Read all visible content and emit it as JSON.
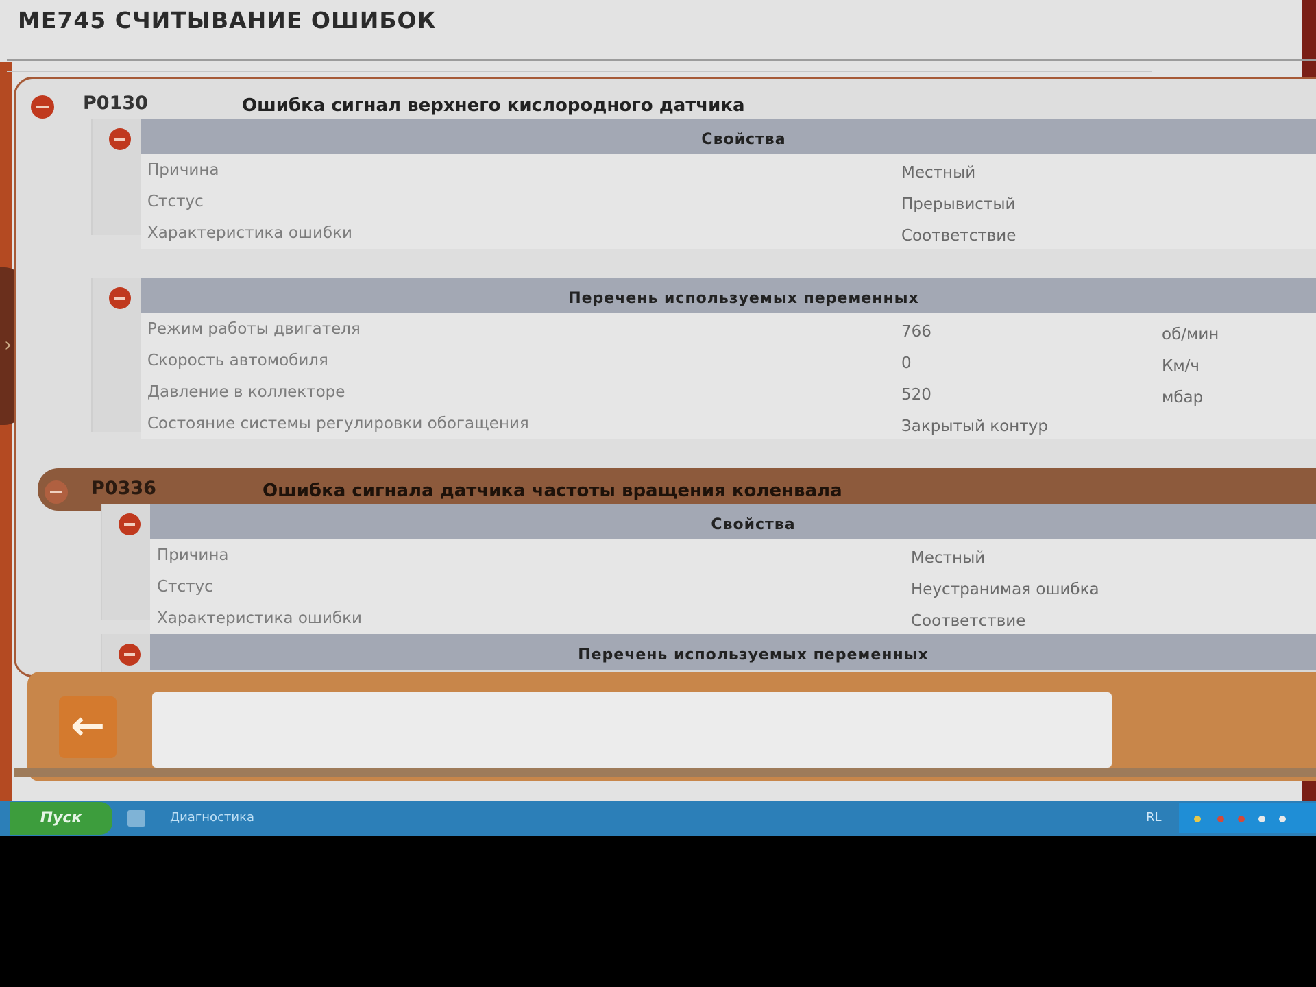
{
  "header": {
    "title": "ME745  СЧИТЫВАНИЕ ОШИБОК"
  },
  "faults": [
    {
      "code": "P0130",
      "description": "Ошибка сигнал верхнего кислородного датчика",
      "properties": {
        "heading": "Свойства",
        "rows": [
          {
            "label": "Причина",
            "value": "Местный"
          },
          {
            "label": "Стстус",
            "value": "Прерывистый"
          },
          {
            "label": "Характеристика ошибки",
            "value": "Соответствие"
          }
        ]
      },
      "variables": {
        "heading": "Перечень используемых переменных",
        "rows": [
          {
            "label": "Режим работы двигателя",
            "value": "766",
            "unit": "об/мин"
          },
          {
            "label": "Скорость автомобиля",
            "value": "0",
            "unit": "Км/ч"
          },
          {
            "label": "Давление в коллекторе",
            "value": "520",
            "unit": "мбар"
          },
          {
            "label": "Состояние системы регулировки обогащения",
            "value": "Закрытый контур",
            "unit": ""
          }
        ]
      }
    },
    {
      "code": "P0336",
      "description": "Ошибка сигнала датчика частоты вращения коленвала",
      "properties": {
        "heading": "Свойства",
        "rows": [
          {
            "label": "Причина",
            "value": "Местный"
          },
          {
            "label": "Стстус",
            "value": "Неустранимая ошибка"
          },
          {
            "label": "Характеристика ошибки",
            "value": "Соответствие"
          }
        ]
      },
      "variables": {
        "heading": "Перечень используемых переменных"
      }
    }
  ],
  "footer": {
    "back_icon": "arrow-left-icon",
    "message": ""
  },
  "taskbar": {
    "start_label": "Пуск",
    "task_label": "Диагностика",
    "language": "RL"
  },
  "colors": {
    "accent": "#c0391e",
    "frame": "#a65a37",
    "section_header": "#a3a8b4",
    "taskbar": "#2c7fb8"
  }
}
